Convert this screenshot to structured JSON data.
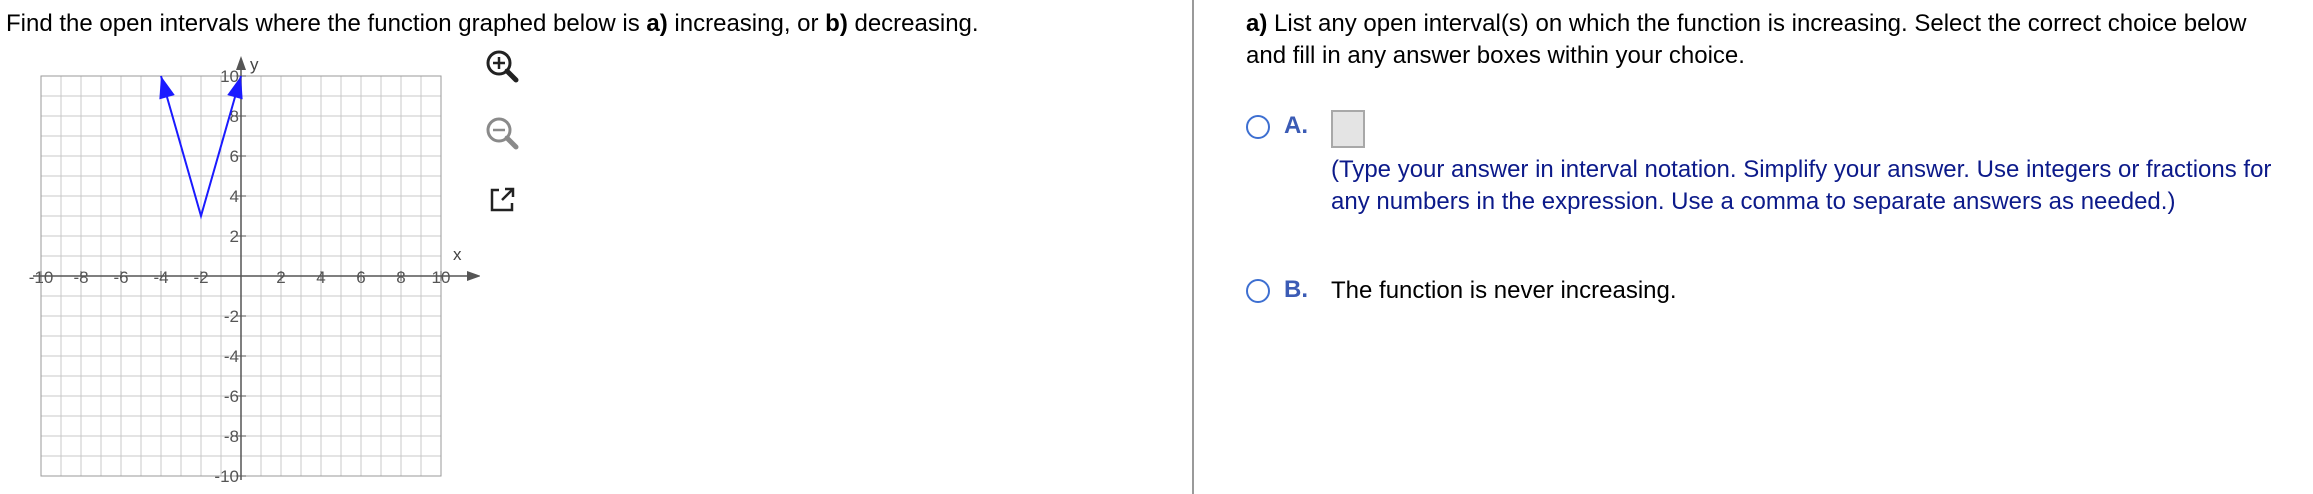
{
  "left": {
    "question": {
      "pre": "Find the open intervals where the function graphed below is ",
      "a_label": "a)",
      "a_text": " increasing, or ",
      "b_label": "b)",
      "b_text": " decreasing."
    },
    "graph": {
      "x_axis_label": "x",
      "y_axis_label": "y",
      "x_ticks": [
        "-10",
        "-8",
        "-6",
        "-4",
        "-2",
        "2",
        "4",
        "6",
        "8",
        "10"
      ],
      "y_ticks": [
        "10",
        "8",
        "6",
        "4",
        "2",
        "-2",
        "-4",
        "-6",
        "-8",
        "-10"
      ],
      "curve_points": [
        [
          -4,
          10
        ],
        [
          -2,
          3
        ],
        [
          0,
          10
        ]
      ],
      "x_range": [
        -10,
        10
      ],
      "y_range": [
        -10,
        10
      ],
      "grid_step": 1,
      "curve_color": "#1a1aff"
    },
    "tools": [
      {
        "name": "zoom-in-icon"
      },
      {
        "name": "zoom-out-icon"
      },
      {
        "name": "pop-out-icon"
      }
    ]
  },
  "right": {
    "prompt": {
      "part_label": "a)",
      "text": " List any open interval(s) on which the function is increasing. Select the correct choice below and fill in any answer boxes within your choice."
    },
    "choices": [
      {
        "letter": "A.",
        "answer_value": "",
        "instructions": "(Type your answer in interval notation. Simplify your answer. Use integers or fractions for any numbers in the expression. Use a comma to separate answers as needed.)"
      },
      {
        "letter": "B.",
        "text": "The function is never increasing."
      }
    ],
    "colors": {
      "radio": "#3d6fd1",
      "letter": "#3b5bb5",
      "instructions": "#0c1a8a"
    }
  }
}
